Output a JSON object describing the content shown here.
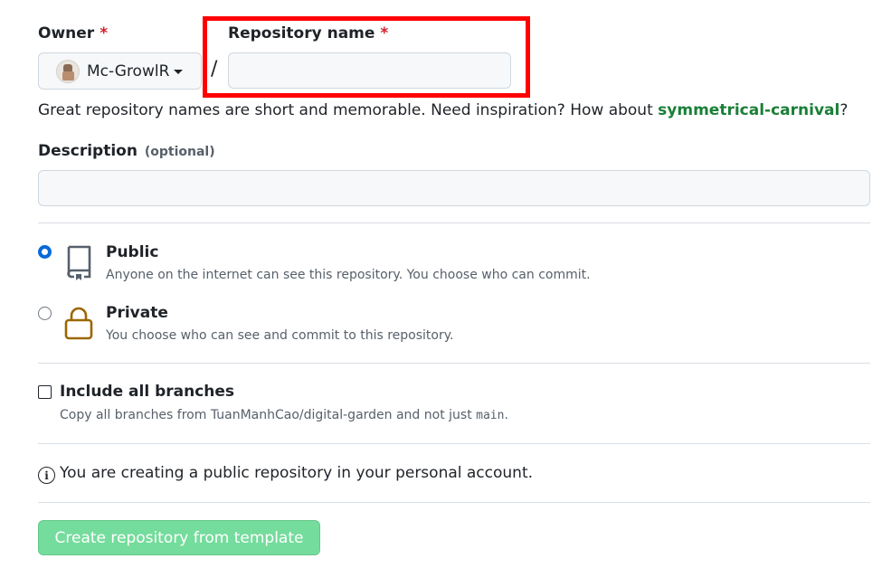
{
  "owner": {
    "label": "Owner",
    "required_mark": "*",
    "selected": "Mc-GrowlR"
  },
  "repo_name": {
    "label": "Repository name",
    "required_mark": "*",
    "value": "",
    "placeholder": ""
  },
  "separator": "/",
  "hint": {
    "prefix": "Great repository names are short and memorable. Need inspiration? How about ",
    "suggestion": "symmetrical-carnival",
    "suffix": "?"
  },
  "description": {
    "label": "Description",
    "optional": "(optional)",
    "value": ""
  },
  "visibility": {
    "public": {
      "title": "Public",
      "desc": "Anyone on the internet can see this repository. You choose who can commit.",
      "checked": true
    },
    "private": {
      "title": "Private",
      "desc": "You choose who can see and commit to this repository.",
      "checked": false
    }
  },
  "branches": {
    "label": "Include all branches",
    "desc_prefix": "Copy all branches from TuanManhCao/digital-garden and not just ",
    "desc_branch": "main",
    "desc_suffix": ".",
    "checked": false
  },
  "notice": {
    "icon_text": "i",
    "text": "You are creating a public repository in your personal account."
  },
  "submit": {
    "label": "Create repository from template"
  },
  "colors": {
    "highlight": "#ff0000",
    "accent_green": "#1a7f37",
    "button_disabled": "#74dc9c",
    "required": "#cf222e",
    "radio_checked": "#0969da",
    "lock_icon": "#9a6700"
  }
}
